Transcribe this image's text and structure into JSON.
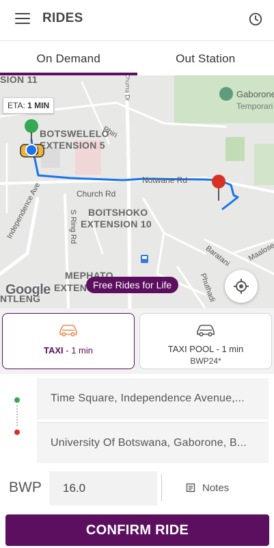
{
  "header": {
    "title": "RIDES",
    "menu_icon": "hamburger-menu-icon",
    "history_icon": "clock-history-icon"
  },
  "tabs": [
    {
      "label": "On Demand",
      "active": true
    },
    {
      "label": "Out Station",
      "active": false
    }
  ],
  "map": {
    "eta_label": "ETA:",
    "eta_value": "1 MIN",
    "promo": "Free Rides for Life",
    "provider": "Google",
    "labels": {
      "area_top_partial": "SION 11",
      "botswelelo_1": "BOTSWELELO",
      "botswelelo_2": "EXTENSION 5",
      "boitshoko_1": "BOITSHOKO",
      "boitshoko_2": "EXTENSION 10",
      "mephato_1": "MEPHATO",
      "mephato_2": "EXTENS",
      "extension_left": "NTLENG",
      "gaborone_1": "Gaborone",
      "gaborone_2": "Temporari",
      "phiri": "Phiri",
      "chuma": "Chuma Dr",
      "notwane": "Notwane Rd",
      "church": "Church Rd",
      "sring": "S Ring Rd",
      "independence": "Independence Ave",
      "baratani": "Baratani",
      "phuthadi": "Phuthadi",
      "maalose": "Maalose"
    },
    "colors": {
      "route": "#1a73e8",
      "pickup_pin": "#34a853",
      "drop_pin": "#d93025"
    }
  },
  "ride_options": [
    {
      "name": "TAXI",
      "eta": "1 min",
      "price": "",
      "selected": true,
      "icon": "car-icon"
    },
    {
      "name": "TAXI POOL",
      "eta": "1 min",
      "price": "BWP24*",
      "selected": false,
      "icon": "car-icon"
    }
  ],
  "locations": {
    "pickup": "Time Square, Independence Avenue,...",
    "dropoff": "University Of Botswana, Gaborone, B..."
  },
  "fare": {
    "currency": "BWP",
    "amount": "16.0",
    "notes_label": "Notes"
  },
  "confirm_label": "CONFIRM RIDE",
  "colors": {
    "brand": "#5b0f5e"
  }
}
